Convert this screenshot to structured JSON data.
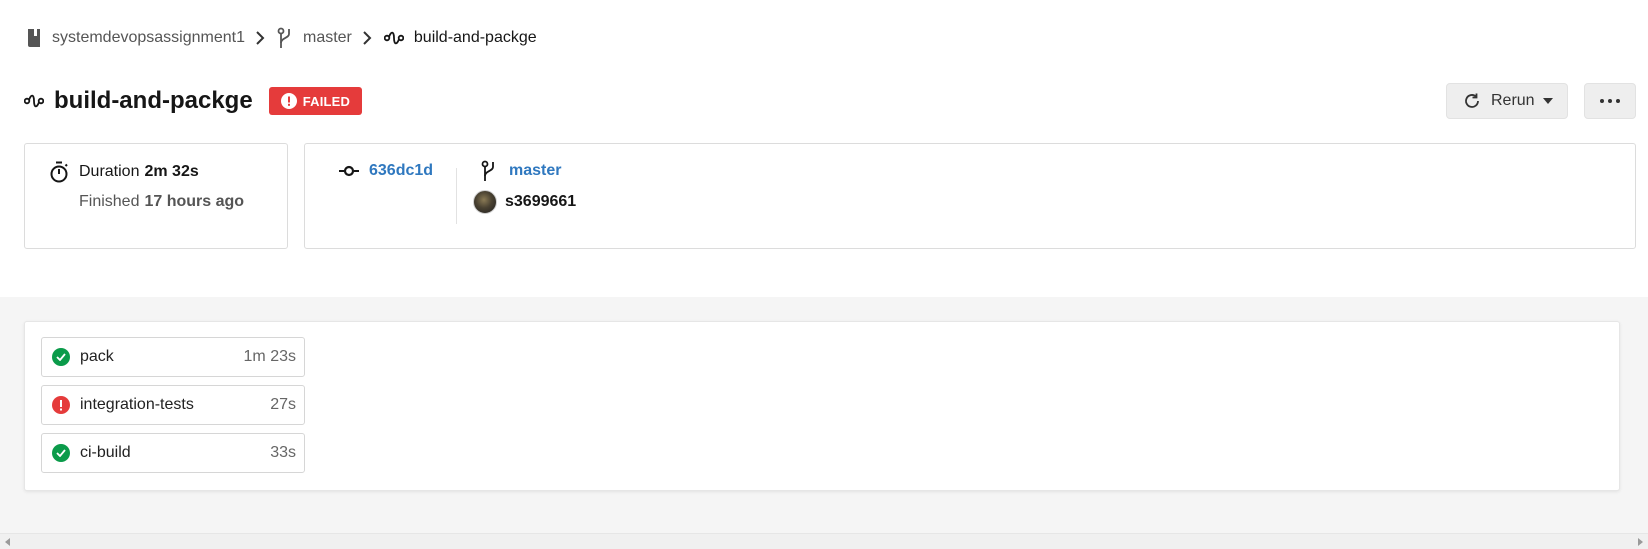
{
  "breadcrumb": {
    "project": "systemdevopsassignment1",
    "branch": "master",
    "workflow": "build-and-packge"
  },
  "header": {
    "title": "build-and-packge",
    "status": "FAILED",
    "rerun_label": "Rerun"
  },
  "summary": {
    "duration_label": "Duration",
    "duration_value": "2m 32s",
    "finished_label": "Finished",
    "finished_value": "17 hours ago"
  },
  "meta": {
    "commit": "636dc1d",
    "branch": "master",
    "user": "s3699661"
  },
  "jobs": [
    {
      "name": "pack",
      "duration": "1m 23s",
      "status": "success"
    },
    {
      "name": "integration-tests",
      "duration": "27s",
      "status": "failed"
    },
    {
      "name": "ci-build",
      "duration": "33s",
      "status": "success"
    }
  ],
  "colors": {
    "failed": "#e53b3b",
    "success": "#0b9b4a",
    "link": "#2f78bf"
  },
  "icons": {
    "project": "repo-book-icon",
    "branch": "git-branch-icon",
    "workflow": "workflow-icon",
    "rerun": "refresh-icon",
    "more": "ellipsis-icon",
    "duration": "stopwatch-icon",
    "commit": "git-commit-icon",
    "success": "check-circle-icon",
    "failed": "exclamation-circle-icon"
  }
}
